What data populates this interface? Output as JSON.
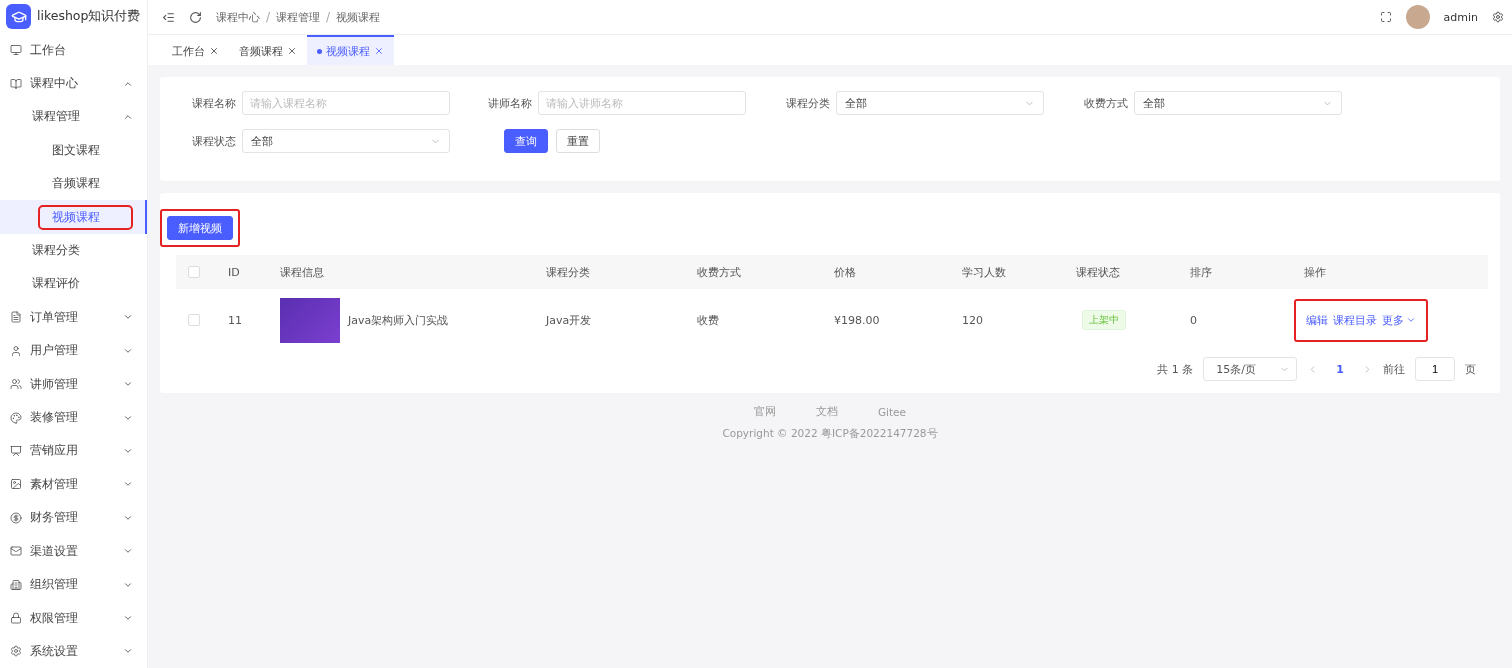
{
  "app": {
    "name": "likeshop知识付费"
  },
  "sidebar": {
    "items": [
      {
        "label": "工作台",
        "kind": "link",
        "selected": false
      },
      {
        "label": "课程中心",
        "kind": "group",
        "expanded": true,
        "children": [
          {
            "label": "课程管理",
            "kind": "group",
            "expanded": true,
            "children": [
              {
                "label": "图文课程",
                "kind": "link",
                "selected": false,
                "highlighted": false
              },
              {
                "label": "音频课程",
                "kind": "link",
                "selected": false,
                "highlighted": false
              },
              {
                "label": "视频课程",
                "kind": "link",
                "selected": true,
                "highlighted": true
              }
            ]
          },
          {
            "label": "课程分类",
            "kind": "link",
            "selected": false
          },
          {
            "label": "课程评价",
            "kind": "link",
            "selected": false
          }
        ]
      },
      {
        "label": "订单管理",
        "kind": "group",
        "expanded": false
      },
      {
        "label": "用户管理",
        "kind": "group",
        "expanded": false
      },
      {
        "label": "讲师管理",
        "kind": "group",
        "expanded": false
      },
      {
        "label": "装修管理",
        "kind": "group",
        "expanded": false
      },
      {
        "label": "营销应用",
        "kind": "group",
        "expanded": false
      },
      {
        "label": "素材管理",
        "kind": "group",
        "expanded": false
      },
      {
        "label": "财务管理",
        "kind": "group",
        "expanded": false
      },
      {
        "label": "渠道设置",
        "kind": "group",
        "expanded": false
      },
      {
        "label": "组织管理",
        "kind": "group",
        "expanded": false
      },
      {
        "label": "权限管理",
        "kind": "group",
        "expanded": false
      },
      {
        "label": "系统设置",
        "kind": "group",
        "expanded": false
      }
    ]
  },
  "header": {
    "breadcrumbs": [
      "课程中心",
      "课程管理",
      "视频课程"
    ],
    "separator": "/",
    "user": "admin"
  },
  "tabs": [
    {
      "label": "工作台",
      "selected": false
    },
    {
      "label": "音频课程",
      "selected": false
    },
    {
      "label": "视频课程",
      "selected": true
    }
  ],
  "filters": [
    {
      "label": "课程名称",
      "kind": "text",
      "placeholder": "请输入课程名称"
    },
    {
      "label": "讲师名称",
      "kind": "text",
      "placeholder": "请输入讲师名称"
    },
    {
      "label": "课程分类",
      "kind": "select",
      "value": "全部"
    },
    {
      "label": "收费方式",
      "kind": "select",
      "value": "全部"
    },
    {
      "label": "课程状态",
      "kind": "select",
      "value": "全部"
    }
  ],
  "filter_buttons": [
    {
      "label": "查询",
      "kind": "primary"
    },
    {
      "label": "重置",
      "kind": "default"
    }
  ],
  "add_button": {
    "label": "新增视频",
    "highlighted": true
  },
  "table": {
    "select_all": {
      "checked": false
    },
    "columns": [
      "ID",
      "课程信息",
      "课程分类",
      "收费方式",
      "价格",
      "学习人数",
      "课程状态",
      "排序",
      "操作"
    ],
    "rows": [
      {
        "checked": false,
        "id": "11",
        "title": "Java架构师入门实战",
        "category": "Java开发",
        "fee": "收费",
        "price": "¥198.00",
        "learners": "120",
        "status": {
          "label": "上架中",
          "kind": "on"
        },
        "sort": "0",
        "actions": [
          "编辑",
          "课程目录",
          "更多"
        ],
        "actions_highlighted": true
      }
    ]
  },
  "pagination": {
    "total": "共 1 条",
    "page_size": "15条/页",
    "pages": [
      {
        "label": "1",
        "selected": true
      }
    ],
    "goto": "前往",
    "goto_value": "1",
    "page_unit": "页"
  },
  "footer": {
    "links": [
      "官网",
      "文档",
      "Gitee"
    ],
    "copyright": "Copyright © 2022 粤ICP备2022147728号"
  }
}
